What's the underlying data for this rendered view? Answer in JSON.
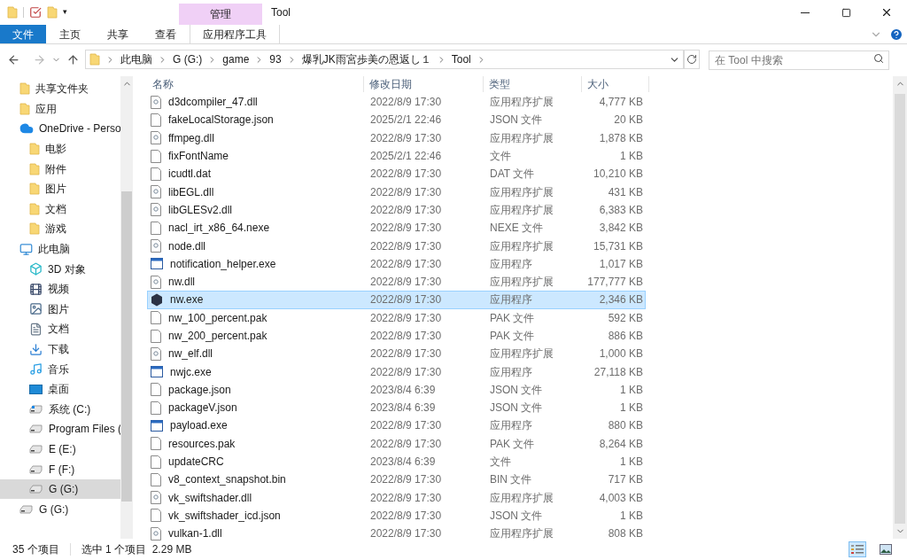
{
  "quick_access": {
    "qat_separator": "▾"
  },
  "window": {
    "context_tab": "管理",
    "title": "Tool"
  },
  "ribbon_tabs": [
    {
      "label": "文件",
      "kind": "file"
    },
    {
      "label": "主页",
      "kind": "tab"
    },
    {
      "label": "共享",
      "kind": "tab"
    },
    {
      "label": "查看",
      "kind": "tab"
    },
    {
      "label": "应用程序工具",
      "kind": "context"
    }
  ],
  "breadcrumb": [
    "此电脑",
    "G (G:)",
    "game",
    "93",
    "爆乳JK雨宮歩美の恩返し１",
    "Tool"
  ],
  "search": {
    "placeholder": "在 Tool 中搜索"
  },
  "sidebar": {
    "items": [
      {
        "label": "共享文件夹",
        "kind": "shared",
        "selected": false
      },
      {
        "label": "应用",
        "kind": "apps",
        "selected": false
      },
      {
        "label": "OneDrive - Perso",
        "kind": "cloud",
        "selected": false,
        "children": [
          {
            "label": "电影",
            "kind": "folder",
            "selected": false
          },
          {
            "label": "附件",
            "kind": "folder",
            "selected": false
          },
          {
            "label": "图片",
            "kind": "folder",
            "selected": false
          },
          {
            "label": "文档",
            "kind": "folder",
            "selected": false
          },
          {
            "label": "游戏",
            "kind": "folder",
            "selected": false
          }
        ]
      },
      {
        "label": "此电脑",
        "kind": "pc",
        "selected": false,
        "children": [
          {
            "label": "3D 对象",
            "kind": "cube",
            "selected": false
          },
          {
            "label": "视频",
            "kind": "video",
            "selected": false
          },
          {
            "label": "图片",
            "kind": "picture",
            "selected": false
          },
          {
            "label": "文档",
            "kind": "doc",
            "selected": false
          },
          {
            "label": "下载",
            "kind": "download",
            "selected": false
          },
          {
            "label": "音乐",
            "kind": "music",
            "selected": false
          },
          {
            "label": "桌面",
            "kind": "desktop",
            "selected": false
          },
          {
            "label": "系统 (C:)",
            "kind": "sysdrive",
            "selected": false
          },
          {
            "label": "Program Files (",
            "kind": "drive",
            "selected": false
          },
          {
            "label": "E (E:)",
            "kind": "drive",
            "selected": false
          },
          {
            "label": "F (F:)",
            "kind": "drive",
            "selected": false
          },
          {
            "label": "G (G:)",
            "kind": "drive",
            "selected": true
          }
        ]
      },
      {
        "label": "G (G:)",
        "kind": "drive",
        "selected": false
      }
    ]
  },
  "table": {
    "columns": [
      "名称",
      "修改日期",
      "类型",
      "大小"
    ],
    "rows": [
      {
        "name": "d3dcompiler_47.dll",
        "date": "2022/8/9 17:30",
        "type": "应用程序扩展",
        "size": "4,777 KB",
        "kind": "dll",
        "selected": false
      },
      {
        "name": "fakeLocalStorage.json",
        "date": "2025/2/1 22:46",
        "type": "JSON 文件",
        "size": "20 KB",
        "kind": "file",
        "selected": false
      },
      {
        "name": "ffmpeg.dll",
        "date": "2022/8/9 17:30",
        "type": "应用程序扩展",
        "size": "1,878 KB",
        "kind": "dll",
        "selected": false
      },
      {
        "name": "fixFontName",
        "date": "2025/2/1 22:46",
        "type": "文件",
        "size": "1 KB",
        "kind": "file",
        "selected": false
      },
      {
        "name": "icudtl.dat",
        "date": "2022/8/9 17:30",
        "type": "DAT 文件",
        "size": "10,210 KB",
        "kind": "file",
        "selected": false
      },
      {
        "name": "libEGL.dll",
        "date": "2022/8/9 17:30",
        "type": "应用程序扩展",
        "size": "431 KB",
        "kind": "dll",
        "selected": false
      },
      {
        "name": "libGLESv2.dll",
        "date": "2022/8/9 17:30",
        "type": "应用程序扩展",
        "size": "6,383 KB",
        "kind": "dll",
        "selected": false
      },
      {
        "name": "nacl_irt_x86_64.nexe",
        "date": "2022/8/9 17:30",
        "type": "NEXE 文件",
        "size": "3,842 KB",
        "kind": "file",
        "selected": false
      },
      {
        "name": "node.dll",
        "date": "2022/8/9 17:30",
        "type": "应用程序扩展",
        "size": "15,731 KB",
        "kind": "dll",
        "selected": false
      },
      {
        "name": "notification_helper.exe",
        "date": "2022/8/9 17:30",
        "type": "应用程序",
        "size": "1,017 KB",
        "kind": "exe",
        "selected": false
      },
      {
        "name": "nw.dll",
        "date": "2022/8/9 17:30",
        "type": "应用程序扩展",
        "size": "177,777 KB",
        "kind": "dll",
        "selected": false
      },
      {
        "name": "nw.exe",
        "date": "2022/8/9 17:30",
        "type": "应用程序",
        "size": "2,346 KB",
        "kind": "app",
        "selected": true
      },
      {
        "name": "nw_100_percent.pak",
        "date": "2022/8/9 17:30",
        "type": "PAK 文件",
        "size": "592 KB",
        "kind": "file",
        "selected": false
      },
      {
        "name": "nw_200_percent.pak",
        "date": "2022/8/9 17:30",
        "type": "PAK 文件",
        "size": "886 KB",
        "kind": "file",
        "selected": false
      },
      {
        "name": "nw_elf.dll",
        "date": "2022/8/9 17:30",
        "type": "应用程序扩展",
        "size": "1,000 KB",
        "kind": "dll",
        "selected": false
      },
      {
        "name": "nwjc.exe",
        "date": "2022/8/9 17:30",
        "type": "应用程序",
        "size": "27,118 KB",
        "kind": "exe",
        "selected": false
      },
      {
        "name": "package.json",
        "date": "2023/8/4 6:39",
        "type": "JSON 文件",
        "size": "1 KB",
        "kind": "file",
        "selected": false
      },
      {
        "name": "packageV.json",
        "date": "2023/8/4 6:39",
        "type": "JSON 文件",
        "size": "1 KB",
        "kind": "file",
        "selected": false
      },
      {
        "name": "payload.exe",
        "date": "2022/8/9 17:30",
        "type": "应用程序",
        "size": "880 KB",
        "kind": "exe",
        "selected": false
      },
      {
        "name": "resources.pak",
        "date": "2022/8/9 17:30",
        "type": "PAK 文件",
        "size": "8,264 KB",
        "kind": "file",
        "selected": false
      },
      {
        "name": "updateCRC",
        "date": "2023/8/4 6:39",
        "type": "文件",
        "size": "1 KB",
        "kind": "file",
        "selected": false
      },
      {
        "name": "v8_context_snapshot.bin",
        "date": "2022/8/9 17:30",
        "type": "BIN 文件",
        "size": "717 KB",
        "kind": "file",
        "selected": false
      },
      {
        "name": "vk_swiftshader.dll",
        "date": "2022/8/9 17:30",
        "type": "应用程序扩展",
        "size": "4,003 KB",
        "kind": "dll",
        "selected": false
      },
      {
        "name": "vk_swiftshader_icd.json",
        "date": "2022/8/9 17:30",
        "type": "JSON 文件",
        "size": "1 KB",
        "kind": "file",
        "selected": false
      },
      {
        "name": "vulkan-1.dll",
        "date": "2022/8/9 17:30",
        "type": "应用程序扩展",
        "size": "808 KB",
        "kind": "dll",
        "selected": false
      }
    ]
  },
  "status_bar": {
    "count": "35 个项目",
    "selection": "选中 1 个项目  2.29 MB"
  },
  "view_modes": [
    {
      "kind": "details",
      "selected": true
    },
    {
      "kind": "tiles",
      "selected": false
    }
  ]
}
